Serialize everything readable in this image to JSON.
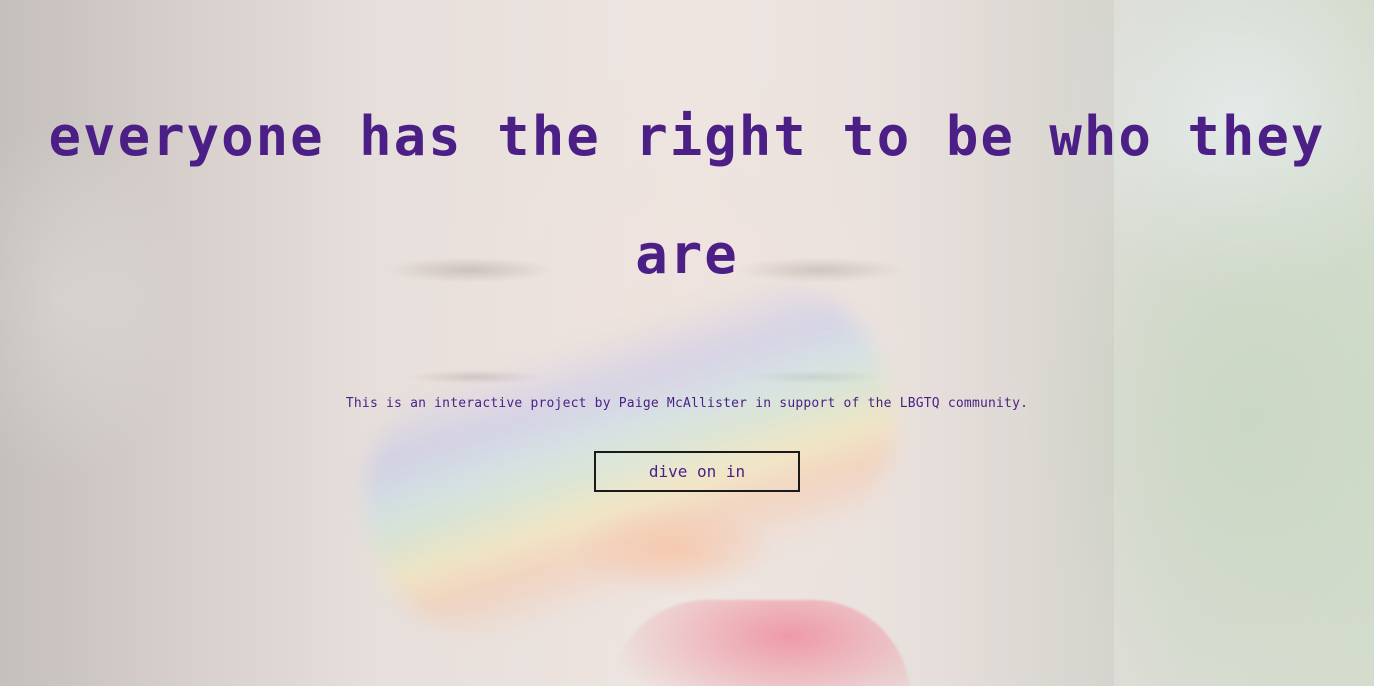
{
  "hero": {
    "headline": "everyone has the right to be who they are",
    "subtext": "This is an interactive project by Paige McAllister in support of the LBGTQ community.",
    "cta_label": "dive on in"
  },
  "colors": {
    "text": "#4b1f86",
    "button_border": "#1a1a1a"
  }
}
